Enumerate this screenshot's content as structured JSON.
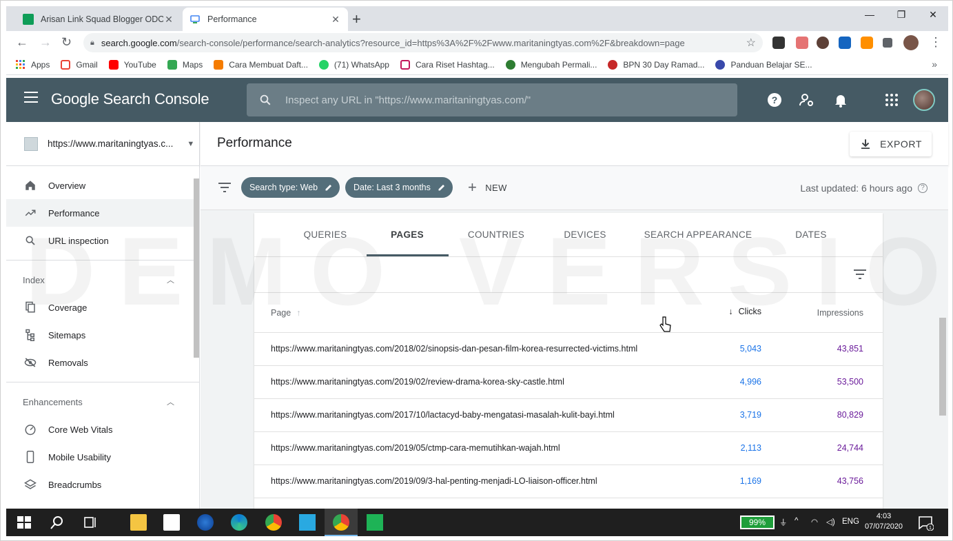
{
  "browser": {
    "tabs": [
      {
        "title": "Arisan Link Squad Blogger ODOP",
        "favicon_color": "#0f9d58",
        "active": false
      },
      {
        "title": "Performance",
        "favicon_color": "#4285f4",
        "active": true
      }
    ],
    "url_host": "search.google.com",
    "url_path": "/search-console/performance/search-analytics?resource_id=https%3A%2F%2Fwww.maritaningtyas.com%2F&breakdown=page",
    "bookmarks": [
      {
        "label": "Apps",
        "icon": "apps-grid-icon",
        "color": "#ea4335"
      },
      {
        "label": "Gmail",
        "icon": "gmail-icon",
        "color": "#ea4335"
      },
      {
        "label": "YouTube",
        "icon": "youtube-icon",
        "color": "#ff0000"
      },
      {
        "label": "Maps",
        "icon": "maps-icon",
        "color": "#34a853"
      },
      {
        "label": "Cara Membuat Daft...",
        "icon": "blogger-icon",
        "color": "#f57c00"
      },
      {
        "label": "(71) WhatsApp",
        "icon": "whatsapp-icon",
        "color": "#25d366"
      },
      {
        "label": "Cara Riset Hashtag...",
        "icon": "hashtag-site-icon",
        "color": "#c2185b"
      },
      {
        "label": "Mengubah Permali...",
        "icon": "gear-site-icon",
        "color": "#2e7d32"
      },
      {
        "label": "BPN 30 Day Ramad...",
        "icon": "bpn-icon",
        "color": "#c62828"
      },
      {
        "label": "Panduan Belajar SE...",
        "icon": "p-site-icon",
        "color": "#3949ab"
      }
    ]
  },
  "gsc": {
    "logo_text": "Google Search Console",
    "search_placeholder": "Inspect any URL in \"https://www.maritaningtyas.com/\"",
    "property": "https://www.maritaningtyas.c...",
    "nav": {
      "top": [
        {
          "label": "Overview",
          "icon": "home-icon",
          "selected": false
        },
        {
          "label": "Performance",
          "icon": "trending-up-icon",
          "selected": true
        },
        {
          "label": "URL inspection",
          "icon": "search-icon",
          "selected": false
        }
      ],
      "index_heading": "Index",
      "index": [
        {
          "label": "Coverage",
          "icon": "coverage-icon"
        },
        {
          "label": "Sitemaps",
          "icon": "sitemap-icon"
        },
        {
          "label": "Removals",
          "icon": "removals-icon"
        }
      ],
      "enh_heading": "Enhancements",
      "enhancements": [
        {
          "label": "Core Web Vitals",
          "icon": "speed-icon"
        },
        {
          "label": "Mobile Usability",
          "icon": "phone-icon"
        },
        {
          "label": "Breadcrumbs",
          "icon": "layers-icon"
        }
      ]
    },
    "page_title": "Performance",
    "export_label": "EXPORT",
    "chips": [
      "Search type: Web",
      "Date: Last 3 months"
    ],
    "new_label": "NEW",
    "last_updated": "Last updated: 6 hours ago",
    "report_tabs": [
      "QUERIES",
      "PAGES",
      "COUNTRIES",
      "DEVICES",
      "SEARCH APPEARANCE",
      "DATES"
    ],
    "active_tab": "PAGES",
    "columns": {
      "page": "Page",
      "clicks": "Clicks",
      "impressions": "Impressions"
    },
    "rows": [
      {
        "url": "https://www.maritaningtyas.com/2018/02/sinopsis-dan-pesan-film-korea-resurrected-victims.html",
        "clicks": "5,043",
        "impressions": "43,851"
      },
      {
        "url": "https://www.maritaningtyas.com/2019/02/review-drama-korea-sky-castle.html",
        "clicks": "4,996",
        "impressions": "53,500"
      },
      {
        "url": "https://www.maritaningtyas.com/2017/10/lactacyd-baby-mengatasi-masalah-kulit-bayi.html",
        "clicks": "3,719",
        "impressions": "80,829"
      },
      {
        "url": "https://www.maritaningtyas.com/2019/05/ctmp-cara-memutihkan-wajah.html",
        "clicks": "2,113",
        "impressions": "24,744"
      },
      {
        "url": "https://www.maritaningtyas.com/2019/09/3-hal-penting-menjadi-LO-liaison-officer.html",
        "clicks": "1,169",
        "impressions": "43,756"
      }
    ],
    "header_color": "#455a64",
    "clicks_color": "#1a73e8",
    "impressions_color": "#6a1b9a"
  },
  "watermark": "DEMO VERSION",
  "taskbar": {
    "battery": "99%",
    "lang": "ENG",
    "time": "4:03",
    "date": "07/07/2020",
    "notifications": "1"
  }
}
